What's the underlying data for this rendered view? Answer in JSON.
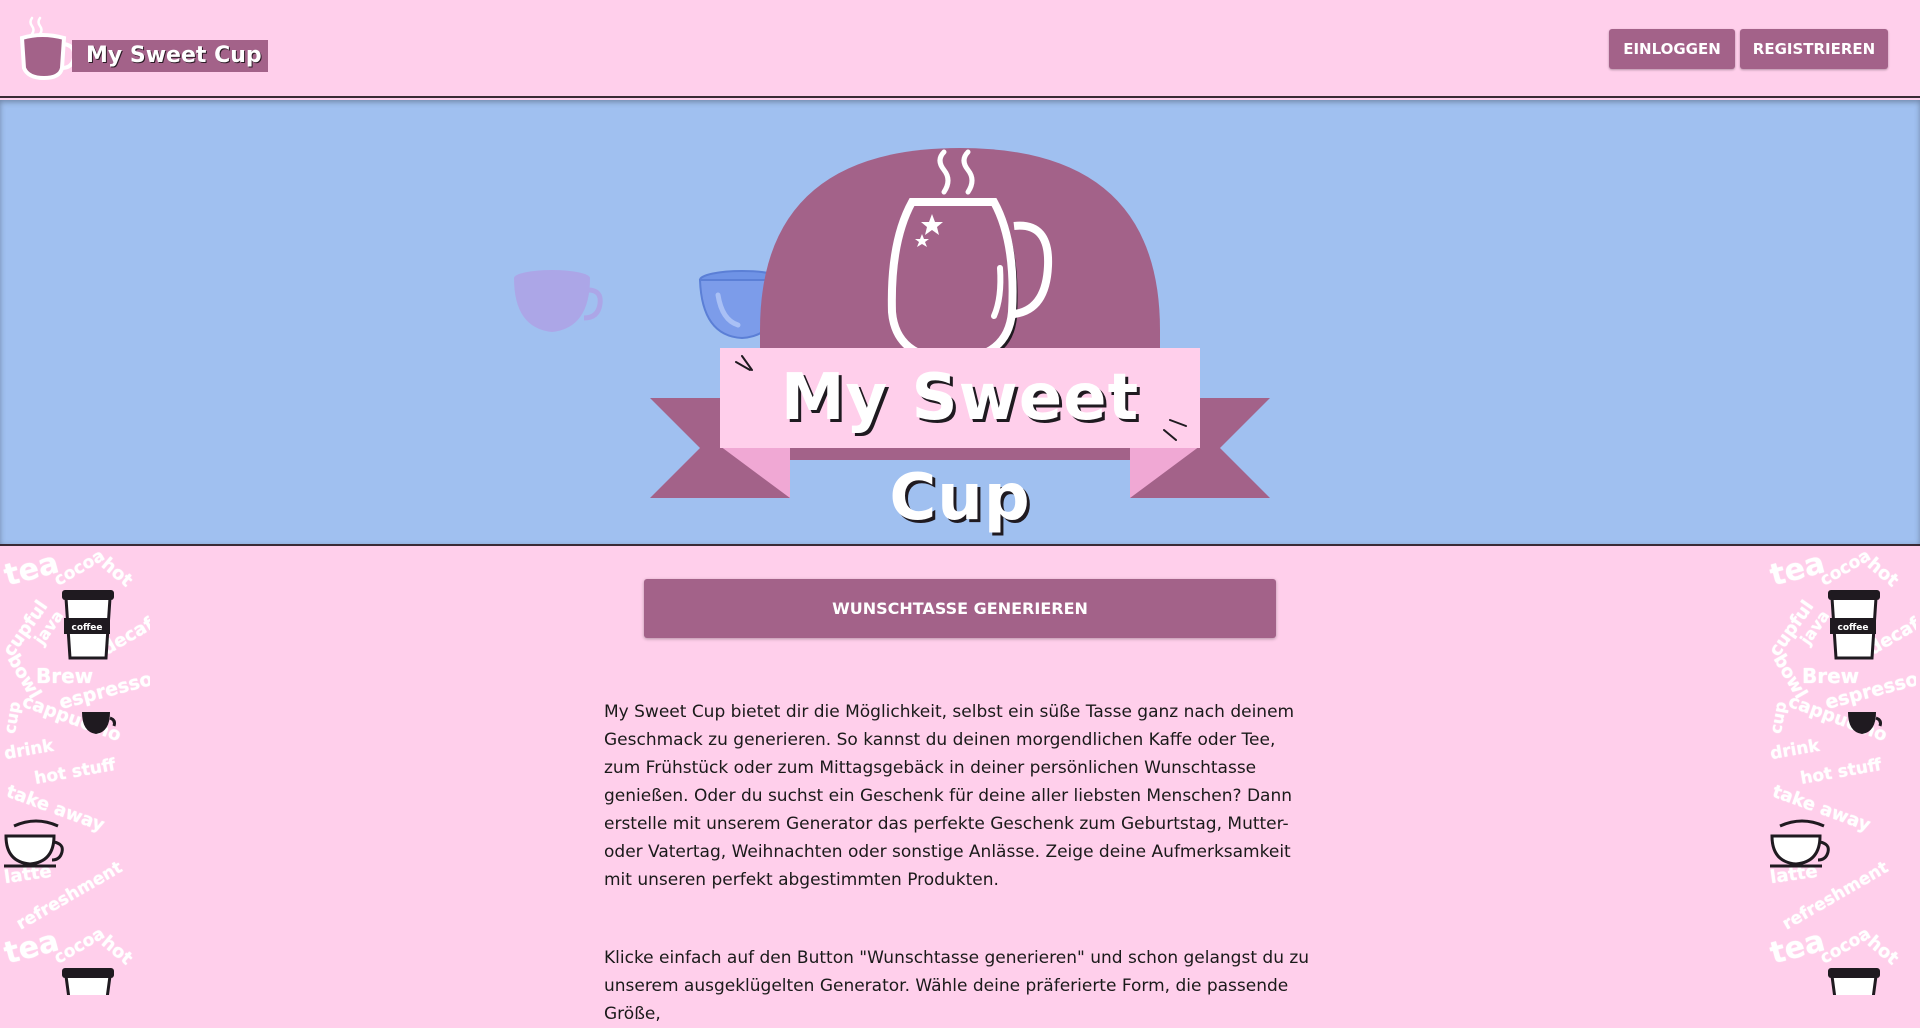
{
  "header": {
    "logo_text": "My Sweet Cup",
    "login_label": "EINLOGGEN",
    "register_label": "REGISTRIEREN"
  },
  "hero": {
    "title": "My Sweet Cup"
  },
  "main": {
    "generate_button_label": "WUNSCHTASSE GENERIEREN",
    "paragraph_1": "My Sweet Cup bietet dir die Möglichkeit, selbst ein süße Tasse ganz nach deinem Geschmack zu generieren. So kannst du deinen morgendlichen Kaffe oder Tee, zum Frühstück oder zum Mittagsgebäck in deiner persönlichen Wunschtasse genießen. Oder du suchst ein Geschenk für deine aller liebsten Menschen? Dann erstelle mit unserem Generator das perfekte Geschenk zum Geburtstag, Mutter- oder Vatertag, Weihnachten oder sonstige Anlässe. Zeige deine Aufmerksamkeit mit unseren perfekt abgestimmten Produkten.",
    "paragraph_2": "Klicke einfach auf den Button \"Wunschtasse generieren\" und schon gelangst du zu unserem ausgeklügelten Generator. Wähle deine präferierte Form, die passende Größe,"
  },
  "decoration_words": [
    "tea",
    "cocoa",
    "hot",
    "cupful",
    "java",
    "decaf",
    "bowl",
    "Brew",
    "espresso",
    "cup",
    "cappucino",
    "drink",
    "hot stuff",
    "take away",
    "latte",
    "refreshment",
    "coffee"
  ],
  "colors": {
    "background": "#ffcfeb",
    "accent": "#a36289",
    "hero_background": "#a0c0f0",
    "ribbon_light": "#ffcfeb",
    "ribbon_fold": "#f0a8d4"
  }
}
